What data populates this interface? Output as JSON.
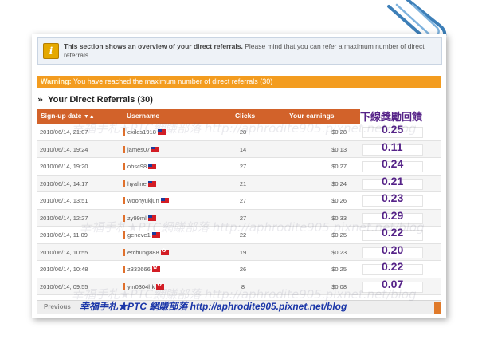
{
  "info": {
    "bold": "This section shows an overview of your direct referrals.",
    "text": " Please mind that you can refer a maximum number of direct referrals."
  },
  "warning": {
    "label": "Warning:",
    "text": " You have reached the maximum number of direct referrals (30)"
  },
  "section_title": "Your Direct Referrals (30)",
  "table": {
    "headers": [
      "Sign-up date",
      "Username",
      "Clicks",
      "Your earnings"
    ],
    "reward_header": "下線獎勵回饋",
    "rows": [
      {
        "date": "2010/06/14, 21:07",
        "user": "exiles1918",
        "flag": "tw",
        "clicks": "28",
        "earn": "$0.28",
        "reward": "0.25"
      },
      {
        "date": "2010/06/14, 19:24",
        "user": "james07",
        "flag": "tw",
        "clicks": "14",
        "earn": "$0.13",
        "reward": "0.11"
      },
      {
        "date": "2010/06/14, 19:20",
        "user": "ohsc98",
        "flag": "tw",
        "clicks": "27",
        "earn": "$0.27",
        "reward": "0.24"
      },
      {
        "date": "2010/06/14, 14:17",
        "user": "hyaline",
        "flag": "tw",
        "clicks": "21",
        "earn": "$0.24",
        "reward": "0.21"
      },
      {
        "date": "2010/06/14, 13:51",
        "user": "woohyukjun",
        "flag": "tw",
        "clicks": "27",
        "earn": "$0.26",
        "reward": "0.23"
      },
      {
        "date": "2010/06/14, 12:27",
        "user": "zy99ml",
        "flag": "tw",
        "clicks": "27",
        "earn": "$0.33",
        "reward": "0.29"
      },
      {
        "date": "2010/06/14, 11:09",
        "user": "geneve1",
        "flag": "tw",
        "clicks": "22",
        "earn": "$0.25",
        "reward": "0.22"
      },
      {
        "date": "2010/06/14, 10:55",
        "user": "erchung888",
        "flag": "hk",
        "clicks": "19",
        "earn": "$0.23",
        "reward": "0.20"
      },
      {
        "date": "2010/06/14, 10:48",
        "user": "z333666",
        "flag": "hk",
        "clicks": "26",
        "earn": "$0.25",
        "reward": "0.22"
      },
      {
        "date": "2010/06/14, 09:55",
        "user": "yin0304hk",
        "flag": "hk",
        "clicks": "8",
        "earn": "$0.08",
        "reward": "0.07"
      }
    ]
  },
  "footer": {
    "previous": "Previous",
    "blog": "幸福手札★PTC 網賺部落 http://aphrodite905.pixnet.net/blog"
  },
  "watermark": "幸福手札★PTC網賺部落 http://aphrodite905.pixnet.net/blog",
  "colors": {
    "warning_bg": "#f39c1f",
    "header_bg": "#d2622a",
    "reward": "#552288",
    "blog": "#1a36a8"
  }
}
